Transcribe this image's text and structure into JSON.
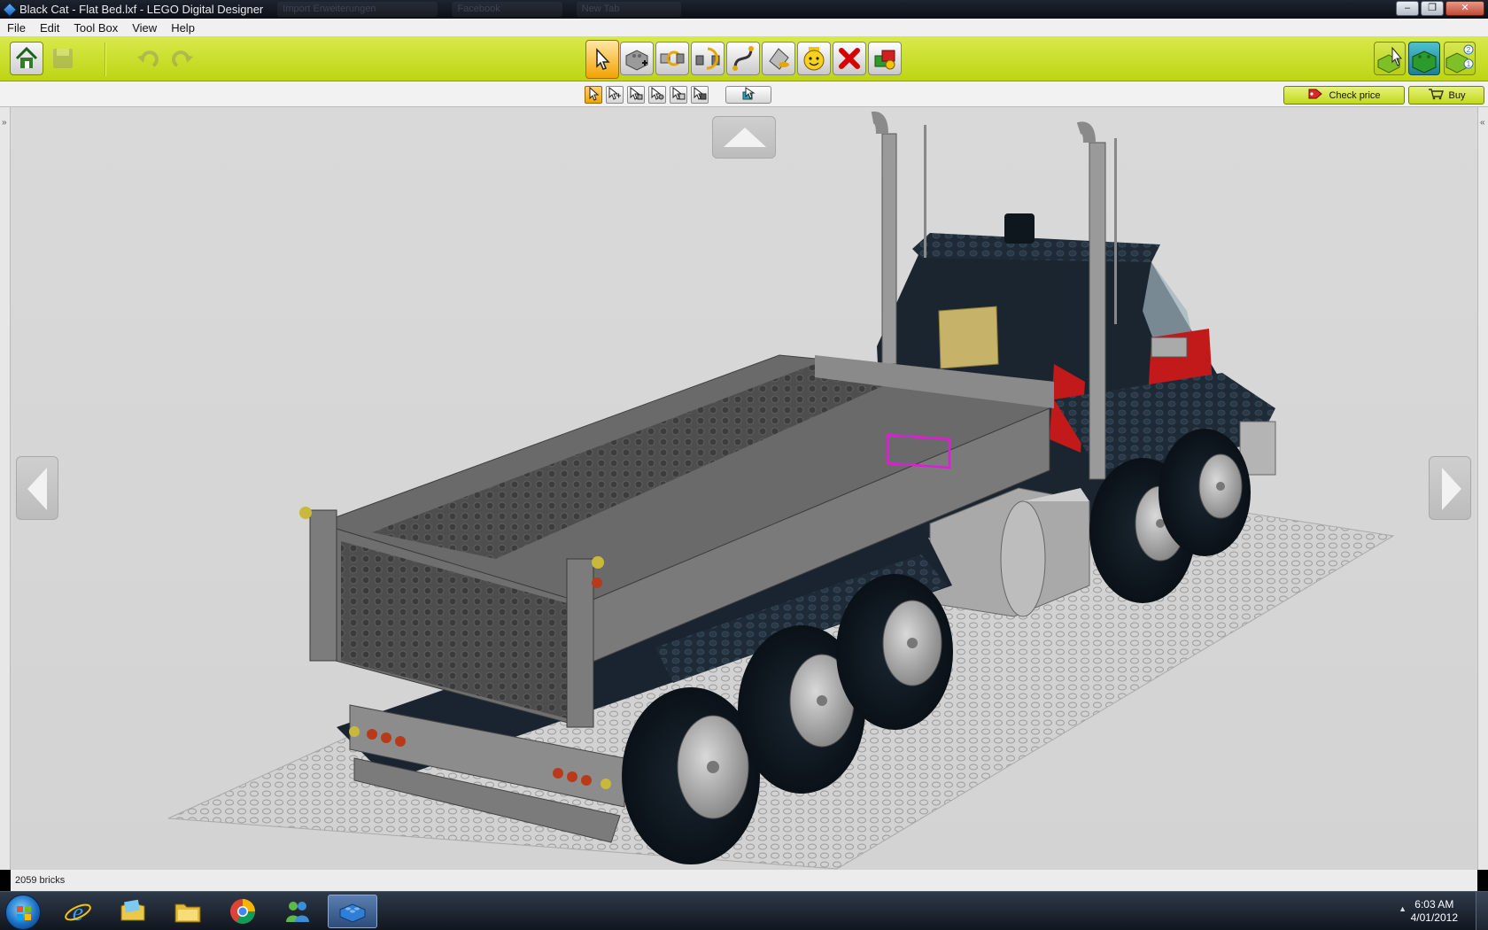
{
  "window": {
    "title": "Black Cat - Flat Bed.lxf - LEGO Digital Designer",
    "background_tabs": [
      "Import Erweiterungen",
      "Facebook",
      "New Tab"
    ],
    "controls": [
      "minimize",
      "restore",
      "close"
    ]
  },
  "menu": [
    "File",
    "Edit",
    "Tool Box",
    "View",
    "Help"
  ],
  "toolbar": {
    "left": [
      "home-icon",
      "save-icon",
      "undo-icon",
      "redo-icon"
    ],
    "center": [
      "select-icon",
      "clone-icon",
      "hinge-icon",
      "hinge-align-icon",
      "flex-icon",
      "paint-icon",
      "decorate-icon",
      "delete-icon",
      "hide-icon"
    ],
    "right": [
      "build-mode-icon",
      "view-mode-icon",
      "building-guide-icon"
    ]
  },
  "subtoolbar": {
    "selection_modes": [
      "single-select",
      "multi-select",
      "connected-select",
      "color-select",
      "same-brick-select",
      "invert-select"
    ],
    "check_price_label": "Check price",
    "buy_label": "Buy"
  },
  "status": {
    "brick_count": "2059 bricks"
  },
  "taskbar": {
    "apps": [
      "internet-explorer",
      "explorer",
      "file-manager",
      "chrome",
      "messenger",
      "lego-digital-designer"
    ],
    "active_app": "lego-digital-designer",
    "time": "6:03 AM",
    "date": "4/01/2012"
  },
  "colors": {
    "toolbar_lime": "#c4d91c",
    "viewport_bg": "#d6d6d6",
    "truck_body": "#1b2530",
    "bed_gray": "#6f6f6f",
    "selection_magenta": "#e21ad9"
  }
}
